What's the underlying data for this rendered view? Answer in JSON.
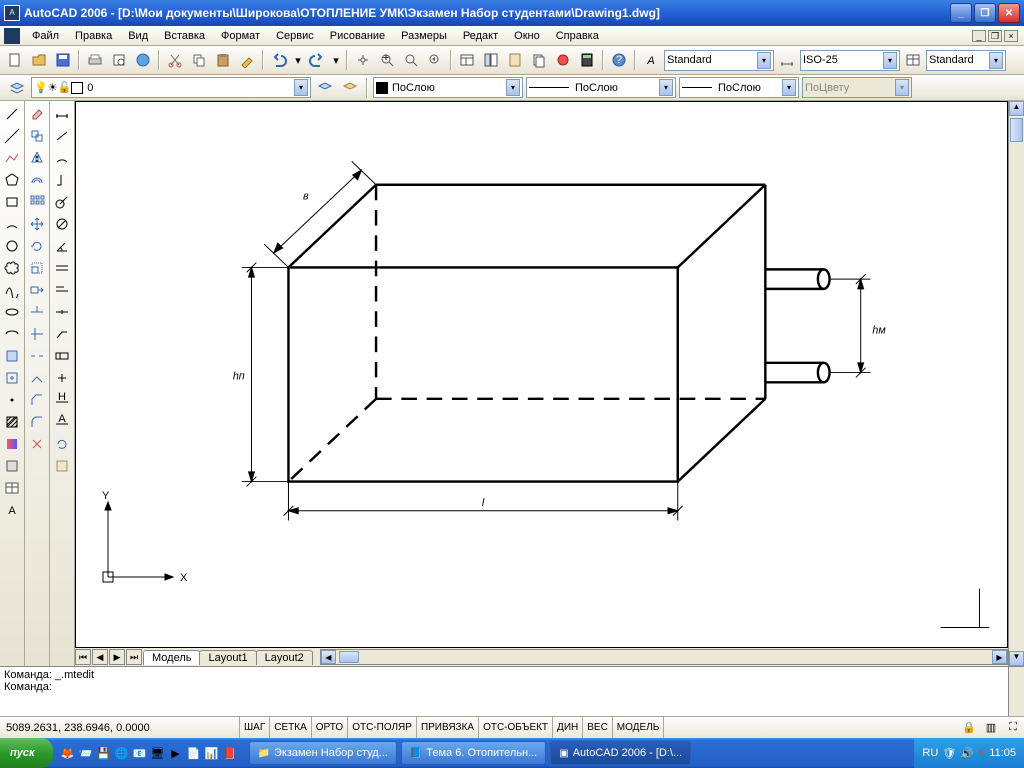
{
  "titlebar": {
    "title": "AutoCAD 2006 - [D:\\Мои документы\\Широкова\\ОТОПЛЕНИЕ УМК\\Экзамен Набор студентами\\Drawing1.dwg]"
  },
  "menu": {
    "items": [
      "Файл",
      "Правка",
      "Вид",
      "Вставка",
      "Формат",
      "Сервис",
      "Рисование",
      "Размеры",
      "Редакт",
      "Окно",
      "Справка"
    ]
  },
  "styles": {
    "textstyle": "Standard",
    "dimstyle": "ISO-25",
    "tablestyle": "Standard"
  },
  "layer": {
    "current": "0",
    "linetype": "ПоСлою",
    "lineweight": "ПоСлою",
    "plotstyle": "ПоСлою",
    "color_mode": "ПоЦвету"
  },
  "tabs": {
    "model": "Модель",
    "layout1": "Layout1",
    "layout2": "Layout2"
  },
  "command": {
    "line1": "Команда: _.mtedit",
    "line2": "Команда:"
  },
  "status": {
    "coords": "5089.2631, 238.6946, 0.0000",
    "snap": "ШАГ",
    "grid": "СЕТКА",
    "ortho": "ОРТО",
    "polar": "ОТС-ПОЛЯР",
    "osnap": "ПРИВЯЗКА",
    "otrack": "ОТС-ОБЪЕКТ",
    "dyn": "ДИН",
    "lwt": "ВЕС",
    "model": "МОДЕЛЬ"
  },
  "taskbar": {
    "start": "пуск",
    "task1": "Экзамен Набор студ...",
    "task2": "Тема 6. Отопительн...",
    "task3": "AutoCAD 2006 - [D:\\...",
    "lang": "RU",
    "clock": "11:05"
  },
  "drawing": {
    "dim_l": "l",
    "dim_hn": "hп",
    "dim_hm": "hм",
    "dim_v": "в",
    "ucs_x": "X",
    "ucs_y": "Y"
  }
}
